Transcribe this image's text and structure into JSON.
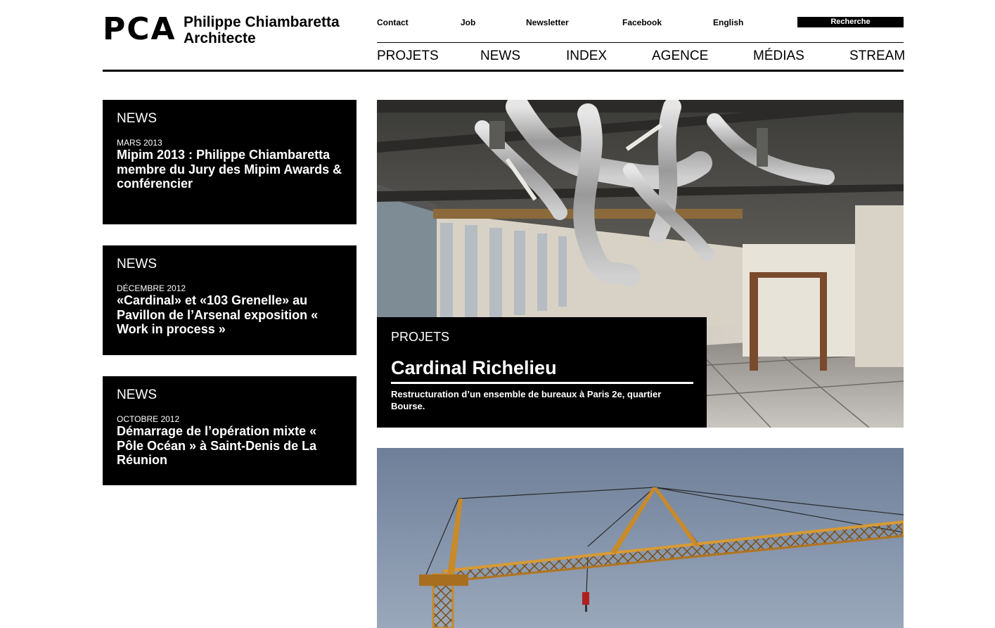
{
  "brand": {
    "mark": "PCA",
    "name_line1": "Philippe Chiambaretta",
    "name_line2": "Architecte"
  },
  "utility_nav": {
    "contact": "Contact",
    "job": "Job",
    "newsletter": "Newsletter",
    "facebook": "Facebook",
    "language": "English",
    "search_placeholder": "Recherche"
  },
  "main_nav": {
    "projets": "PROJETS",
    "news": "NEWS",
    "index": "INDEX",
    "agence": "AGENCE",
    "medias": "MÉDIAS",
    "stream": "STREAM"
  },
  "news": [
    {
      "label": "NEWS",
      "date": "MARS 2013",
      "title": "Mipim 2013 : Philippe Chiambaretta membre du Jury des Mipim Awards & conférencier"
    },
    {
      "label": "NEWS",
      "date": "DÉCEMBRE 2012",
      "title": "«Cardinal» et «103 Grenelle» au Pavillon de l’Arsenal exposition « Work in process »"
    },
    {
      "label": "NEWS",
      "date": "OCTOBRE 2012",
      "title": "Démarrage de l’opération mixte « Pôle Océan » à Saint-Denis de La Réunion"
    }
  ],
  "featured_project": {
    "label": "PROJETS",
    "title": "Cardinal Richelieu",
    "description": "Restructuration d’un ensemble de bureaux à Paris 2e, quartier Bourse."
  },
  "colors": {
    "background": "#ffffff",
    "text": "#000000",
    "card": "#000000",
    "card_text": "#ffffff",
    "crane": "#c88a2a",
    "sky": "#7f90a8"
  }
}
